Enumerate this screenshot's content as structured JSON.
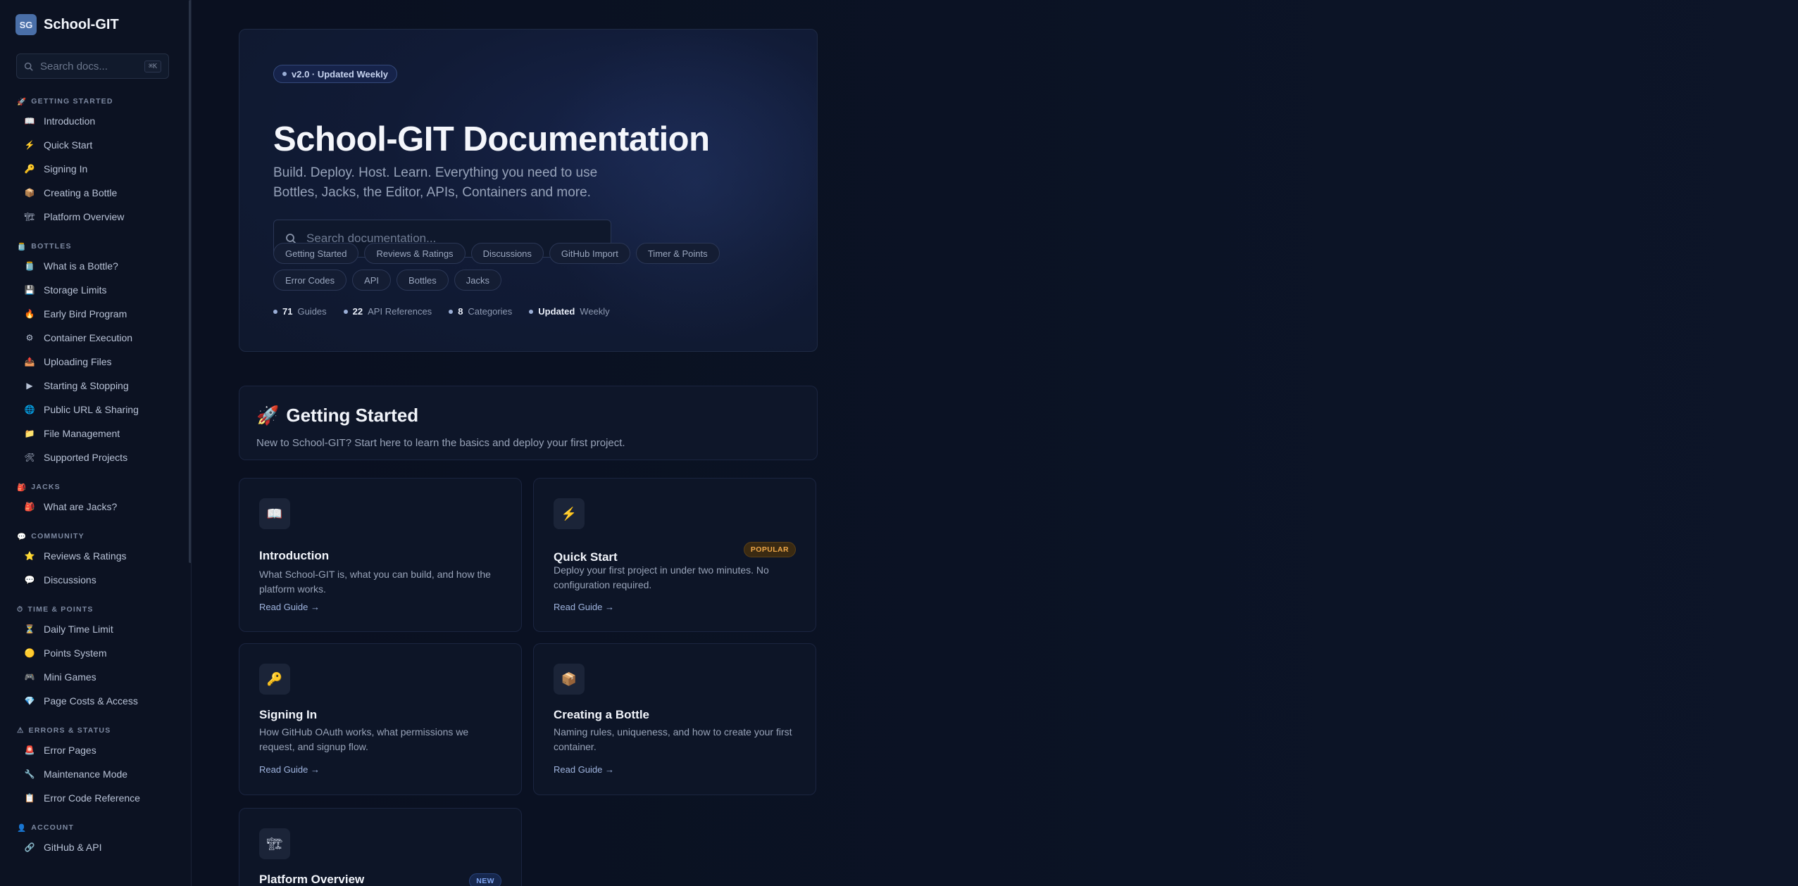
{
  "sidebar": {
    "brand_badge": "SG",
    "brand_name": "School-GIT",
    "search_placeholder": "Search docs...",
    "search_shortcut": "⌘K",
    "groups": [
      {
        "title": "GETTING STARTED",
        "icon": "🚀",
        "items": [
          {
            "label": "Introduction",
            "icon": "📖"
          },
          {
            "label": "Quick Start",
            "icon": "⚡"
          },
          {
            "label": "Signing In",
            "icon": "🔑"
          },
          {
            "label": "Creating a Bottle",
            "icon": "📦"
          },
          {
            "label": "Platform Overview",
            "icon": "🏗"
          }
        ]
      },
      {
        "title": "BOTTLES",
        "icon": "🫙",
        "items": [
          {
            "label": "What is a Bottle?",
            "icon": "🫙"
          },
          {
            "label": "Storage Limits",
            "icon": "💾"
          },
          {
            "label": "Early Bird Program",
            "icon": "🔥"
          },
          {
            "label": "Container Execution",
            "icon": "⚙"
          },
          {
            "label": "Uploading Files",
            "icon": "📤"
          },
          {
            "label": "Starting & Stopping",
            "icon": "▶"
          },
          {
            "label": "Public URL & Sharing",
            "icon": "🌐"
          },
          {
            "label": "File Management",
            "icon": "📁"
          },
          {
            "label": "Supported Projects",
            "icon": "🛠"
          }
        ]
      },
      {
        "title": "JACKS",
        "icon": "🎒",
        "items": [
          {
            "label": "What are Jacks?",
            "icon": "🎒"
          }
        ]
      },
      {
        "title": "COMMUNITY",
        "icon": "💬",
        "items": [
          {
            "label": "Reviews & Ratings",
            "icon": "⭐"
          },
          {
            "label": "Discussions",
            "icon": "💬"
          }
        ]
      },
      {
        "title": "TIME & POINTS",
        "icon": "⏱",
        "items": [
          {
            "label": "Daily Time Limit",
            "icon": "⏳"
          },
          {
            "label": "Points System",
            "icon": "🟡"
          },
          {
            "label": "Mini Games",
            "icon": "🎮"
          },
          {
            "label": "Page Costs & Access",
            "icon": "💎"
          }
        ]
      },
      {
        "title": "ERRORS & STATUS",
        "icon": "⚠",
        "items": [
          {
            "label": "Error Pages",
            "icon": "🚨"
          },
          {
            "label": "Maintenance Mode",
            "icon": "🔧"
          },
          {
            "label": "Error Code Reference",
            "icon": "📋"
          }
        ]
      },
      {
        "title": "ACCOUNT",
        "icon": "👤",
        "items": [
          {
            "label": "GitHub & API",
            "icon": "🔗"
          }
        ]
      }
    ]
  },
  "hero": {
    "version_pill": "v2.0 · Updated Weekly",
    "title": "School-GIT Documentation",
    "subtitle": "Build. Deploy. Host. Learn. Everything you need to use Bottles, Jacks, the Editor, APIs, Containers and more.",
    "search_placeholder": "Search documentation...",
    "chips": [
      "Getting Started",
      "Reviews & Ratings",
      "Discussions",
      "GitHub Import",
      "Timer & Points",
      "Error Codes",
      "API",
      "Bottles",
      "Jacks"
    ],
    "stats": [
      {
        "value": "71",
        "label": "Guides"
      },
      {
        "value": "22",
        "label": "API References"
      },
      {
        "value": "8",
        "label": "Categories"
      },
      {
        "value": "Updated",
        "label": "Weekly"
      }
    ]
  },
  "section": {
    "icon": "🚀",
    "title": "Getting Started",
    "description": "New to School-GIT? Start here to learn the basics and deploy your first project."
  },
  "cards": [
    {
      "icon": "📖",
      "title": "Introduction",
      "description": "What School-GIT is, what you can build, and how the platform works.",
      "link": "Read Guide →",
      "badge": ""
    },
    {
      "icon": "⚡",
      "title": "Quick Start",
      "description": "Deploy your first project in under two minutes. No configuration required.",
      "link": "Read Guide →",
      "badge": "POPULAR"
    },
    {
      "icon": "🔑",
      "title": "Signing In",
      "description": "How GitHub OAuth works, what permissions we request, and signup flow.",
      "link": "Read Guide →",
      "badge": ""
    },
    {
      "icon": "📦",
      "title": "Creating a Bottle",
      "description": "Naming rules, uniqueness, and how to create your first container.",
      "link": "Read Guide →",
      "badge": ""
    },
    {
      "icon": "🏗",
      "title": "Platform Overview",
      "description": "",
      "link": "",
      "badge": "NEW"
    }
  ]
}
